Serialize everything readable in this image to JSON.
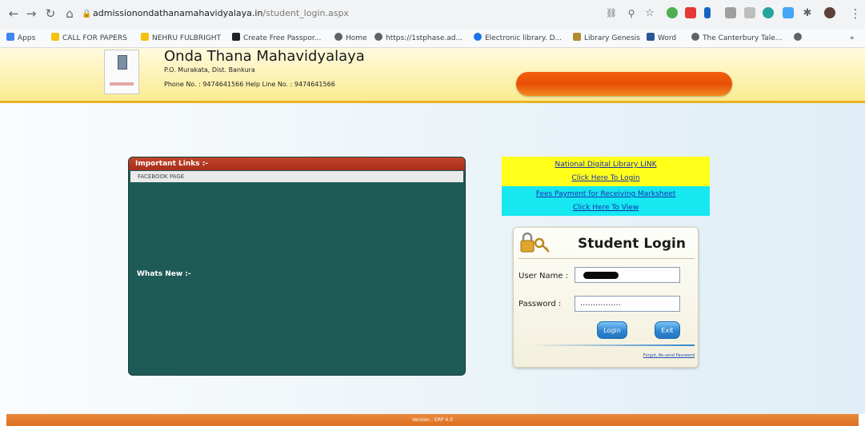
{
  "browser": {
    "url_host": "admissionondathanamahavidyalaya.in",
    "url_path": "/student_login.aspx",
    "bookmarks": [
      {
        "label": "Apps",
        "color": "#4285f4"
      },
      {
        "label": "CALL FOR PAPERS",
        "color": "#f4c20d"
      },
      {
        "label": "NEHRU FULBRIGHT",
        "color": "#f4c20d"
      },
      {
        "label": "Create Free Passpor...",
        "color": "#202124"
      },
      {
        "label": "Home",
        "color": "#5f6368"
      },
      {
        "label": "https://1stphase.ad...",
        "color": "#5f6368"
      },
      {
        "label": "Electronic library. D...",
        "color": "#1a73e8"
      },
      {
        "label": "Library Genesis",
        "color": "#b08a2e"
      },
      {
        "label": "Word",
        "color": "#2b579a"
      },
      {
        "label": "The Canterbury Tale...",
        "color": "#5f6368"
      }
    ]
  },
  "header": {
    "college_name": "Onda Thana Mahavidyalaya",
    "address": "P.O. Murakata, Dist. Bankura",
    "phone": "Phone No. : 9474641566   Help Line No. : 9474641566"
  },
  "links_panel": {
    "heading": "Important Links :-",
    "items": [
      "FACEBOOK PAGE"
    ],
    "whats_new": "Whats New :-"
  },
  "ndl": {
    "link1": "National Digital Library LINK",
    "link2": "Click Here To Login"
  },
  "fees": {
    "link1": "Fees Payment for Receiving Marksheet",
    "link2": "Click Here To View"
  },
  "login": {
    "title": "Student Login",
    "username_label": "User Name :",
    "password_label": "Password :",
    "password_value": "................",
    "login_button": "Login",
    "exit_button": "Exit",
    "forgot_link": "Forgot, Re-send Password"
  },
  "footer": {
    "version": "Version : ERP 4.0"
  },
  "colors": {
    "accent_orange": "#e85007",
    "panel_green": "#1f5b56",
    "panel_red": "#a62f1c",
    "ndl_yellow": "#ffff1a",
    "fees_cyan": "#16e7f0",
    "button_blue": "#2f86d2"
  }
}
